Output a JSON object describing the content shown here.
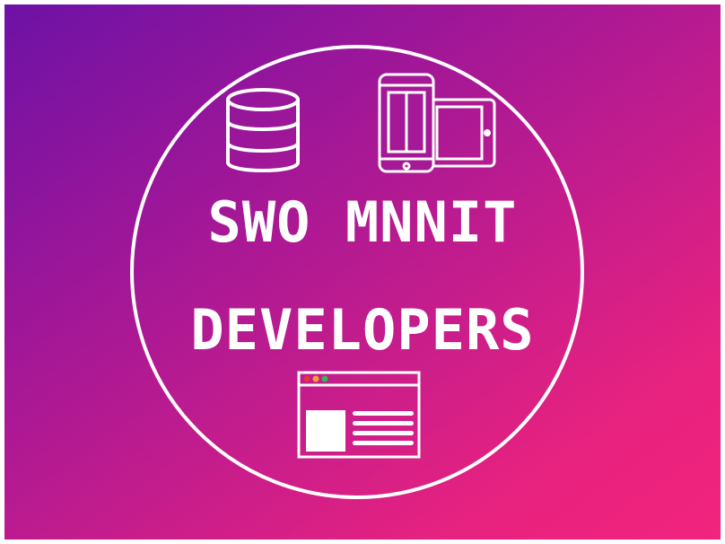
{
  "title": {
    "line1": "SWO MNNIT",
    "line2": "DEVELOPERS"
  },
  "icons": [
    "database-icon",
    "devices-icon",
    "browser-window-icon"
  ],
  "colors": {
    "gradient_start": "#6d12a6",
    "gradient_end": "#f2247d",
    "stroke": "#ffffff",
    "dot_red": "#e0393e",
    "dot_orange": "#f0a23a",
    "dot_green": "#2fbf4a"
  }
}
